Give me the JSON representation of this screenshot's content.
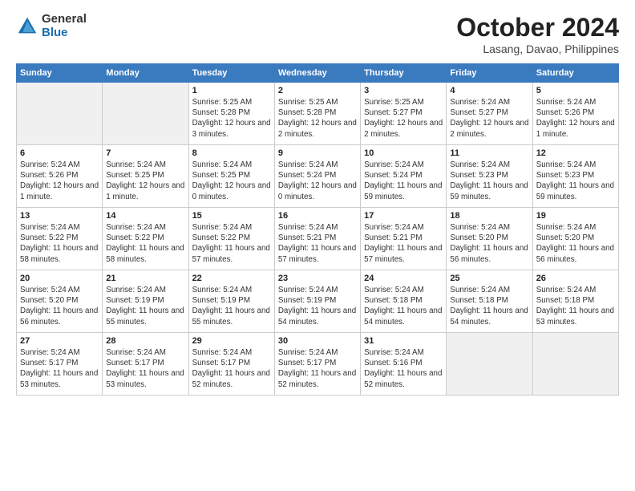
{
  "header": {
    "logo_general": "General",
    "logo_blue": "Blue",
    "month_title": "October 2024",
    "location": "Lasang, Davao, Philippines"
  },
  "weekdays": [
    "Sunday",
    "Monday",
    "Tuesday",
    "Wednesday",
    "Thursday",
    "Friday",
    "Saturday"
  ],
  "weeks": [
    [
      {
        "day": "",
        "info": ""
      },
      {
        "day": "",
        "info": ""
      },
      {
        "day": "1",
        "info": "Sunrise: 5:25 AM\nSunset: 5:28 PM\nDaylight: 12 hours and 3 minutes."
      },
      {
        "day": "2",
        "info": "Sunrise: 5:25 AM\nSunset: 5:28 PM\nDaylight: 12 hours and 2 minutes."
      },
      {
        "day": "3",
        "info": "Sunrise: 5:25 AM\nSunset: 5:27 PM\nDaylight: 12 hours and 2 minutes."
      },
      {
        "day": "4",
        "info": "Sunrise: 5:24 AM\nSunset: 5:27 PM\nDaylight: 12 hours and 2 minutes."
      },
      {
        "day": "5",
        "info": "Sunrise: 5:24 AM\nSunset: 5:26 PM\nDaylight: 12 hours and 1 minute."
      }
    ],
    [
      {
        "day": "6",
        "info": "Sunrise: 5:24 AM\nSunset: 5:26 PM\nDaylight: 12 hours and 1 minute."
      },
      {
        "day": "7",
        "info": "Sunrise: 5:24 AM\nSunset: 5:25 PM\nDaylight: 12 hours and 1 minute."
      },
      {
        "day": "8",
        "info": "Sunrise: 5:24 AM\nSunset: 5:25 PM\nDaylight: 12 hours and 0 minutes."
      },
      {
        "day": "9",
        "info": "Sunrise: 5:24 AM\nSunset: 5:24 PM\nDaylight: 12 hours and 0 minutes."
      },
      {
        "day": "10",
        "info": "Sunrise: 5:24 AM\nSunset: 5:24 PM\nDaylight: 11 hours and 59 minutes."
      },
      {
        "day": "11",
        "info": "Sunrise: 5:24 AM\nSunset: 5:23 PM\nDaylight: 11 hours and 59 minutes."
      },
      {
        "day": "12",
        "info": "Sunrise: 5:24 AM\nSunset: 5:23 PM\nDaylight: 11 hours and 59 minutes."
      }
    ],
    [
      {
        "day": "13",
        "info": "Sunrise: 5:24 AM\nSunset: 5:22 PM\nDaylight: 11 hours and 58 minutes."
      },
      {
        "day": "14",
        "info": "Sunrise: 5:24 AM\nSunset: 5:22 PM\nDaylight: 11 hours and 58 minutes."
      },
      {
        "day": "15",
        "info": "Sunrise: 5:24 AM\nSunset: 5:22 PM\nDaylight: 11 hours and 57 minutes."
      },
      {
        "day": "16",
        "info": "Sunrise: 5:24 AM\nSunset: 5:21 PM\nDaylight: 11 hours and 57 minutes."
      },
      {
        "day": "17",
        "info": "Sunrise: 5:24 AM\nSunset: 5:21 PM\nDaylight: 11 hours and 57 minutes."
      },
      {
        "day": "18",
        "info": "Sunrise: 5:24 AM\nSunset: 5:20 PM\nDaylight: 11 hours and 56 minutes."
      },
      {
        "day": "19",
        "info": "Sunrise: 5:24 AM\nSunset: 5:20 PM\nDaylight: 11 hours and 56 minutes."
      }
    ],
    [
      {
        "day": "20",
        "info": "Sunrise: 5:24 AM\nSunset: 5:20 PM\nDaylight: 11 hours and 56 minutes."
      },
      {
        "day": "21",
        "info": "Sunrise: 5:24 AM\nSunset: 5:19 PM\nDaylight: 11 hours and 55 minutes."
      },
      {
        "day": "22",
        "info": "Sunrise: 5:24 AM\nSunset: 5:19 PM\nDaylight: 11 hours and 55 minutes."
      },
      {
        "day": "23",
        "info": "Sunrise: 5:24 AM\nSunset: 5:19 PM\nDaylight: 11 hours and 54 minutes."
      },
      {
        "day": "24",
        "info": "Sunrise: 5:24 AM\nSunset: 5:18 PM\nDaylight: 11 hours and 54 minutes."
      },
      {
        "day": "25",
        "info": "Sunrise: 5:24 AM\nSunset: 5:18 PM\nDaylight: 11 hours and 54 minutes."
      },
      {
        "day": "26",
        "info": "Sunrise: 5:24 AM\nSunset: 5:18 PM\nDaylight: 11 hours and 53 minutes."
      }
    ],
    [
      {
        "day": "27",
        "info": "Sunrise: 5:24 AM\nSunset: 5:17 PM\nDaylight: 11 hours and 53 minutes."
      },
      {
        "day": "28",
        "info": "Sunrise: 5:24 AM\nSunset: 5:17 PM\nDaylight: 11 hours and 53 minutes."
      },
      {
        "day": "29",
        "info": "Sunrise: 5:24 AM\nSunset: 5:17 PM\nDaylight: 11 hours and 52 minutes."
      },
      {
        "day": "30",
        "info": "Sunrise: 5:24 AM\nSunset: 5:17 PM\nDaylight: 11 hours and 52 minutes."
      },
      {
        "day": "31",
        "info": "Sunrise: 5:24 AM\nSunset: 5:16 PM\nDaylight: 11 hours and 52 minutes."
      },
      {
        "day": "",
        "info": ""
      },
      {
        "day": "",
        "info": ""
      }
    ]
  ]
}
